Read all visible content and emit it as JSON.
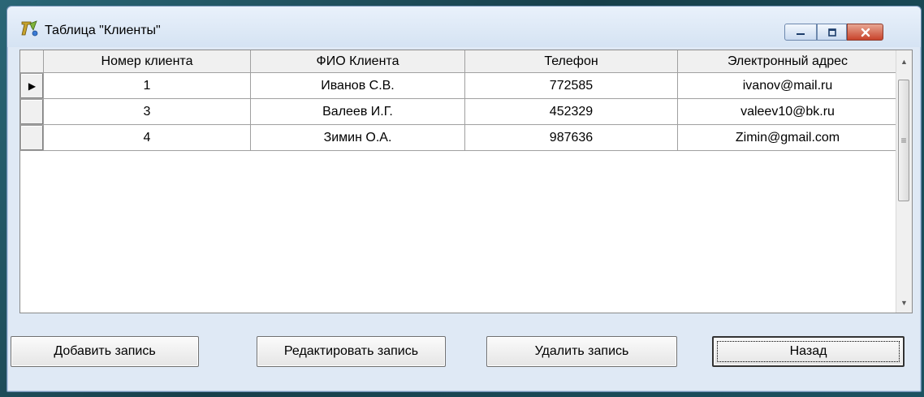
{
  "window": {
    "title": "Таблица \"Клиенты\"",
    "controls": {
      "minimize": "—",
      "maximize": "▢",
      "close": "✕"
    }
  },
  "grid": {
    "columns": [
      "Номер клиента",
      "ФИО Клиента",
      "Телефон",
      "Электронный адрес"
    ],
    "rows": [
      [
        "1",
        "Иванов С.В.",
        "772585",
        "ivanov@mail.ru"
      ],
      [
        "3",
        "Валеев И.Г.",
        "452329",
        "valeev10@bk.ru"
      ],
      [
        "4",
        "Зимин О.А.",
        "987636",
        "Zimin@gmail.com"
      ]
    ],
    "current_row_indicator": "▶",
    "scrollbar": {
      "up": "▲",
      "down": "▼",
      "grip": "≡"
    }
  },
  "buttons": {
    "add": "Добавить запись",
    "edit": "Редактировать запись",
    "delete": "Удалить запись",
    "back": "Назад"
  },
  "colors": {
    "desktop": "#1f4f5c",
    "window_frame": "#dfe9f5",
    "close_button": "#c8432b"
  }
}
